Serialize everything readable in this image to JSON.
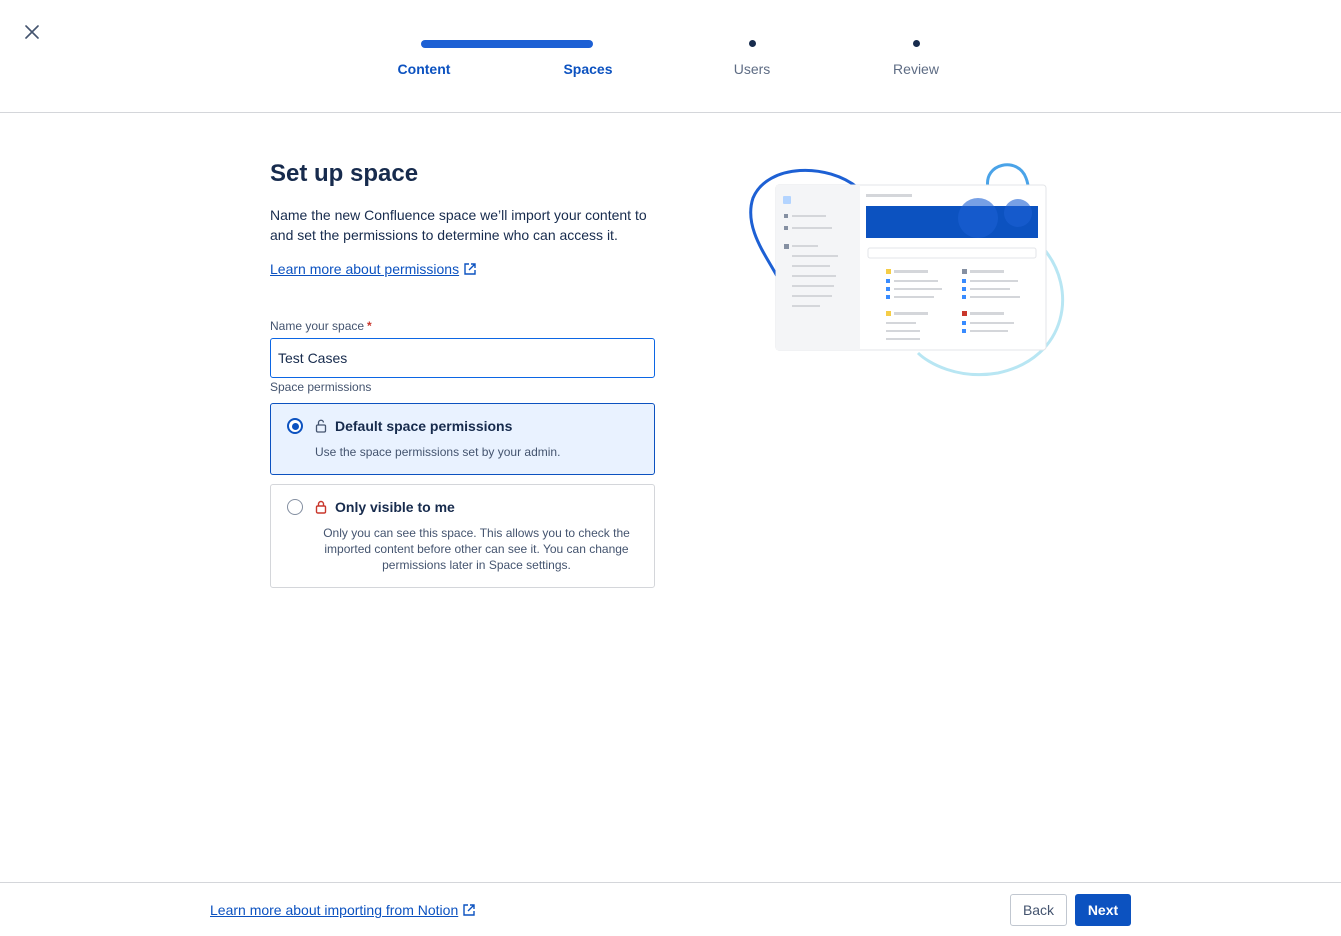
{
  "header": {
    "steps": [
      {
        "label": "Content",
        "state": "done"
      },
      {
        "label": "Spaces",
        "state": "current"
      },
      {
        "label": "Users",
        "state": "upcoming"
      },
      {
        "label": "Review",
        "state": "upcoming"
      }
    ],
    "close_icon": "close-icon"
  },
  "main": {
    "title": "Set up space",
    "description": "Name the new Confluence space we’ll import your content to and set the permissions to determine who can access it.",
    "learn_link": "Learn more about permissions",
    "name_field": {
      "label": "Name your space",
      "required_marker": "*",
      "value": "Test Cases"
    },
    "permissions": {
      "label": "Space permissions",
      "options": [
        {
          "title": "Default space permissions",
          "description": "Use the space permissions set by your admin.",
          "selected": true,
          "icon": "unlock-icon"
        },
        {
          "title": "Only visible to me",
          "description": "Only you can see this space. This allows you to check the imported content before other can see it. You can change permissions later in Space settings.",
          "selected": false,
          "icon": "lock-icon"
        }
      ]
    }
  },
  "footer": {
    "learn_link": "Learn more about importing from Notion",
    "back_label": "Back",
    "next_label": "Next"
  },
  "colors": {
    "accent": "#0c52c0",
    "progress": "#1d60d4",
    "selected_bg": "#e9f2ff",
    "danger_lock": "#c9372c"
  }
}
